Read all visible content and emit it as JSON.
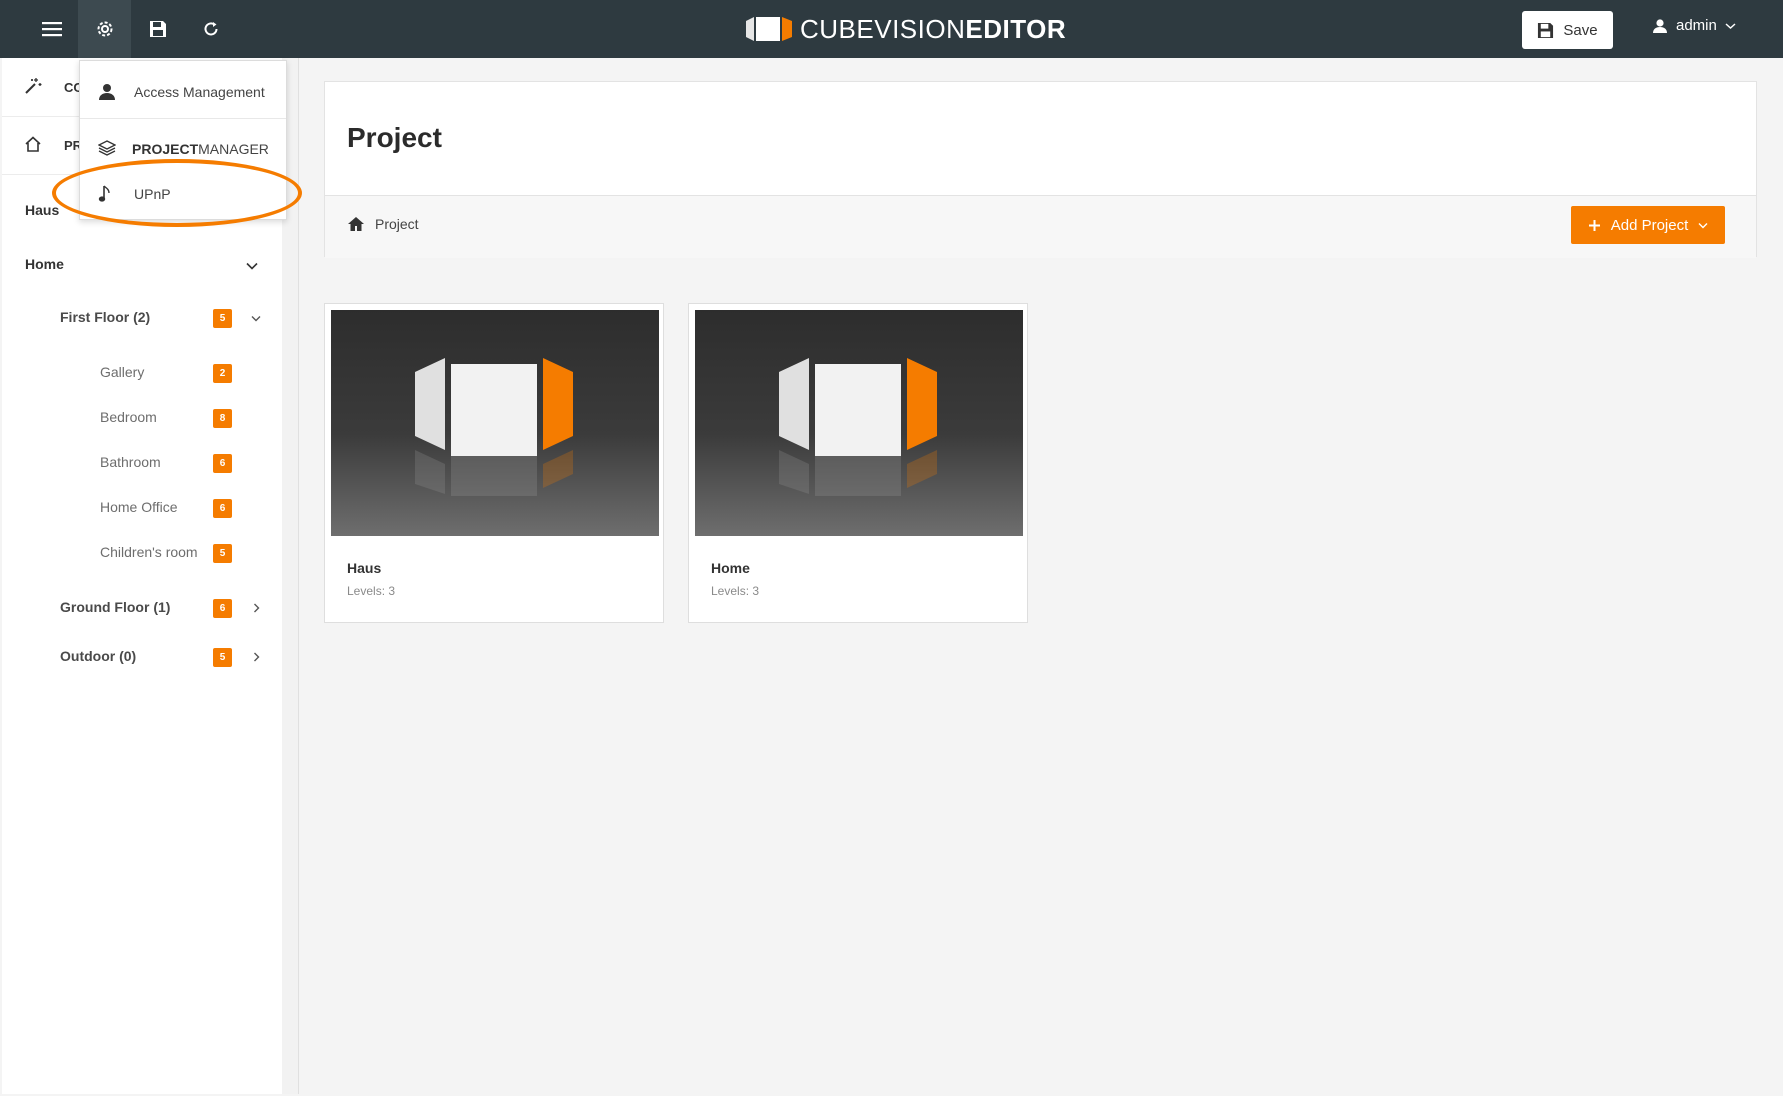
{
  "app": {
    "logo_part1": "CUBEVISION",
    "logo_part2": "EDITOR"
  },
  "toolbar": {
    "save_label": "Save",
    "user_label": "admin"
  },
  "settings_menu": {
    "items": [
      {
        "label": "Access Management",
        "icon": "user-icon"
      },
      {
        "label_bold": "PROJECT",
        "label_rest": "MANAGER",
        "icon": "layers-icon"
      },
      {
        "label": "UPnP",
        "icon": "music-note-icon"
      }
    ]
  },
  "sidebar": {
    "top_items": [
      {
        "label": "CO",
        "icon": "magic-wand-icon"
      },
      {
        "label": "PR",
        "icon": "home-icon"
      }
    ],
    "projects": [
      {
        "label": "Haus"
      },
      {
        "label": "Home"
      }
    ],
    "floors": [
      {
        "label": "First Floor (2)",
        "badge": "5"
      },
      {
        "label": "Ground Floor (1)",
        "badge": "6"
      },
      {
        "label": "Outdoor (0)",
        "badge": "5"
      }
    ],
    "rooms": [
      {
        "label": "Gallery",
        "badge": "2"
      },
      {
        "label": "Bedroom",
        "badge": "8"
      },
      {
        "label": "Bathroom",
        "badge": "6"
      },
      {
        "label": "Home Office",
        "badge": "6"
      },
      {
        "label": "Children's room",
        "badge": "5"
      }
    ]
  },
  "main": {
    "title": "Project",
    "breadcrumb": "Project",
    "add_button": "Add Project",
    "cards": [
      {
        "name": "Haus",
        "levels": "Levels: 3"
      },
      {
        "name": "Home",
        "levels": "Levels: 3"
      }
    ]
  },
  "colors": {
    "accent": "#f57c00",
    "topbar": "#2e3a40"
  }
}
